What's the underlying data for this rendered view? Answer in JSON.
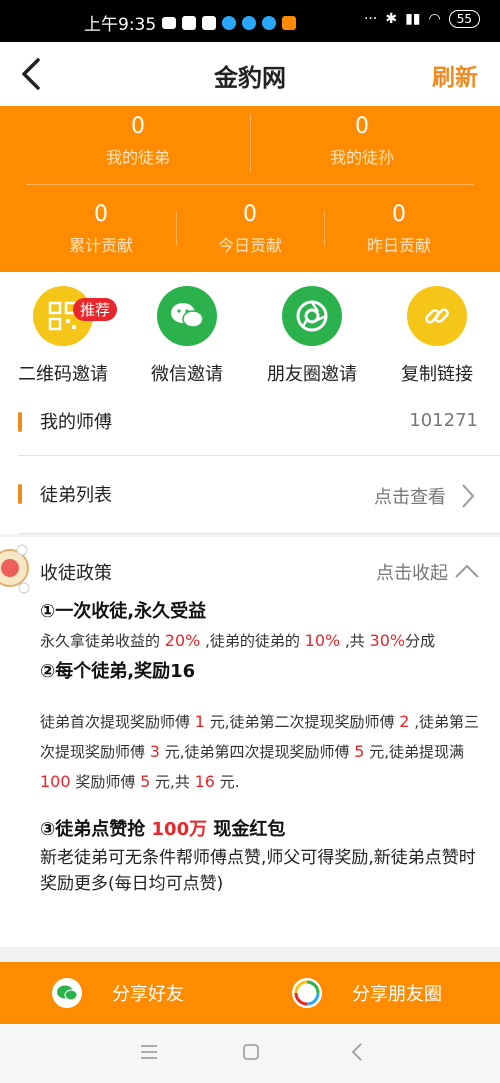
{
  "status": {
    "time": "上午9:35",
    "icons": [
      "message-icon",
      "play-store-icon",
      "app-icon",
      "app-icon",
      "app-icon",
      "app-icon",
      "weibo-icon"
    ],
    "more": "···",
    "right_icons": [
      "bluetooth-icon",
      "signal-icon",
      "wifi-icon"
    ],
    "battery": "55"
  },
  "header": {
    "title": "金豹网",
    "refresh": "刷新"
  },
  "stats": {
    "my_apprentice": {
      "value": "0",
      "label": "我的徒弟"
    },
    "my_grand": {
      "value": "0",
      "label": "我的徒孙"
    },
    "total": {
      "value": "0",
      "label": "累计贡献"
    },
    "today": {
      "value": "0",
      "label": "今日贡献"
    },
    "yesterday": {
      "value": "0",
      "label": "昨日贡献"
    }
  },
  "invites": {
    "badge": "推荐",
    "qr": "二维码邀请",
    "wechat": "微信邀请",
    "moments": "朋友圈邀请",
    "copy": "复制链接"
  },
  "master": {
    "label": "我的师傅",
    "value": "101271"
  },
  "apprentices": {
    "label": "徒弟列表",
    "action": "点击查看"
  },
  "policy": {
    "title": "收徒政策",
    "collapse": "点击收起",
    "h1": "①一次收徒,永久受益",
    "p1": {
      "a": "永久拿徒弟收益的 ",
      "v1": "20%",
      "b": " ,徒弟的徒弟的 ",
      "v2": "10%",
      "c": " ,共 ",
      "v3": "30%",
      "d": "分成"
    },
    "h2": "②每个徒弟,奖励16",
    "p2": {
      "a": "徒弟首次提现奖励师傅 ",
      "v1": "1",
      "b": " 元,徒弟第二次提现奖励师傅 ",
      "v2": "2",
      "c": " ,徒弟第三次提现奖励师傅 ",
      "v3": "3",
      "d": " 元,徒弟第四次提现奖励师傅 ",
      "v4": "5",
      "e": " 元,徒弟提现满 ",
      "v5": "100",
      "f": " 奖励师傅 ",
      "v6": "5",
      "g": " 元,共 ",
      "v7": "16",
      "h": " 元."
    },
    "h3a": "③徒弟点赞抢 ",
    "h3v": "100万",
    "h3b": " 现金红包",
    "p3": "新老徒弟可无条件帮师傅点赞,师父可得奖励,新徒弟点赞时奖励更多(每日均可点赞)"
  },
  "share": {
    "friends": "分享好友",
    "moments": "分享朋友圈"
  },
  "colors": {
    "orange": "#ff8c00",
    "accent": "#f08a1c",
    "red": "#e8262c",
    "wechat": "#2bb24c",
    "yellow": "#f5c518"
  }
}
